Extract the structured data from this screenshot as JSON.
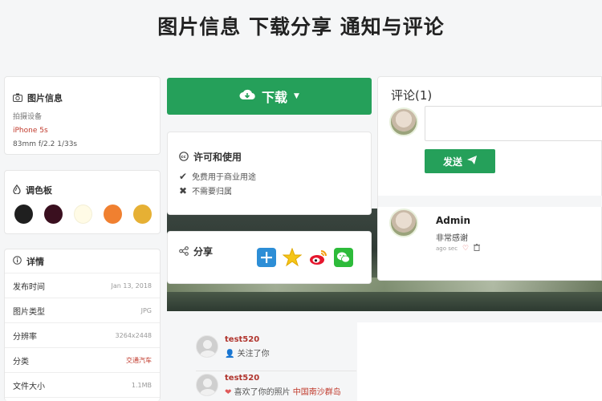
{
  "page_title": "图片信息 下载分享 通知与评论",
  "info": {
    "heading": "图片信息",
    "device_label": "拍摄设备",
    "device": "iPhone 5s",
    "specs": "83mm  f/2.2  1/33s"
  },
  "palette": {
    "heading": "调色板",
    "colors": [
      "#1f1f1f",
      "#3a0f1f",
      "#fffbe6",
      "#f08030",
      "#e6b034"
    ]
  },
  "details": {
    "heading": "详情",
    "rows": [
      {
        "label": "发布时间",
        "value": "Jan 13, 2018"
      },
      {
        "label": "图片类型",
        "value": "JPG"
      },
      {
        "label": "分辨率",
        "value": "3264x2448"
      },
      {
        "label": "分类",
        "value": "交通汽车"
      },
      {
        "label": "文件大小",
        "value": "1.1MB"
      }
    ]
  },
  "download": {
    "label": "下载"
  },
  "license": {
    "heading": "许可和使用",
    "items": [
      "免费用于商业用途",
      "不需要归属"
    ]
  },
  "share": {
    "heading": "分享"
  },
  "comments": {
    "title": "评论(1)",
    "send_label": "发送",
    "comment": {
      "author": "Admin",
      "text": "非常感谢",
      "time": "ago sec"
    }
  },
  "activity": [
    {
      "user": "test520",
      "action": "关注了你"
    },
    {
      "user": "test520",
      "action": "喜欢了你的照片",
      "target": "中国南沙群岛"
    }
  ]
}
